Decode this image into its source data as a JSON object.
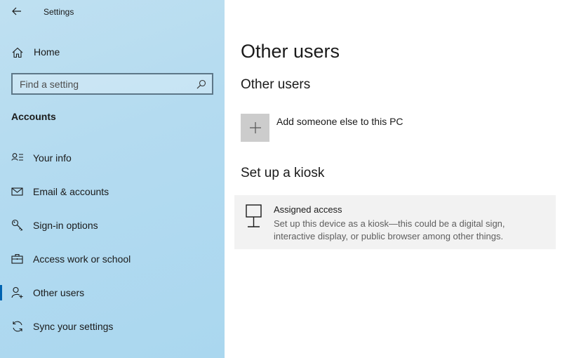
{
  "window": {
    "title": "Settings"
  },
  "sidebar": {
    "home_label": "Home",
    "search": {
      "placeholder": "Find a setting",
      "value": ""
    },
    "section_heading": "Accounts",
    "items": [
      {
        "label": "Your info",
        "icon": "contact-info-icon",
        "active": false
      },
      {
        "label": "Email & accounts",
        "icon": "mail-icon",
        "active": false
      },
      {
        "label": "Sign-in options",
        "icon": "key-icon",
        "active": false
      },
      {
        "label": "Access work or school",
        "icon": "briefcase-icon",
        "active": false
      },
      {
        "label": "Other users",
        "icon": "add-person-icon",
        "active": true
      },
      {
        "label": "Sync your settings",
        "icon": "sync-icon",
        "active": false
      }
    ]
  },
  "main": {
    "page_title": "Other users",
    "other_users_heading": "Other users",
    "add_user_label": "Add someone else to this PC",
    "kiosk_heading": "Set up a kiosk",
    "kiosk_card": {
      "title": "Assigned access",
      "description": "Set up this device as a kiosk—this could be a digital sign, interactive display, or public browser among other things."
    }
  },
  "colors": {
    "accent": "#0063b1",
    "sidebar_background": "#b4dbf0",
    "card_background": "#f2f2f2",
    "plus_tile": "#cccccc"
  }
}
